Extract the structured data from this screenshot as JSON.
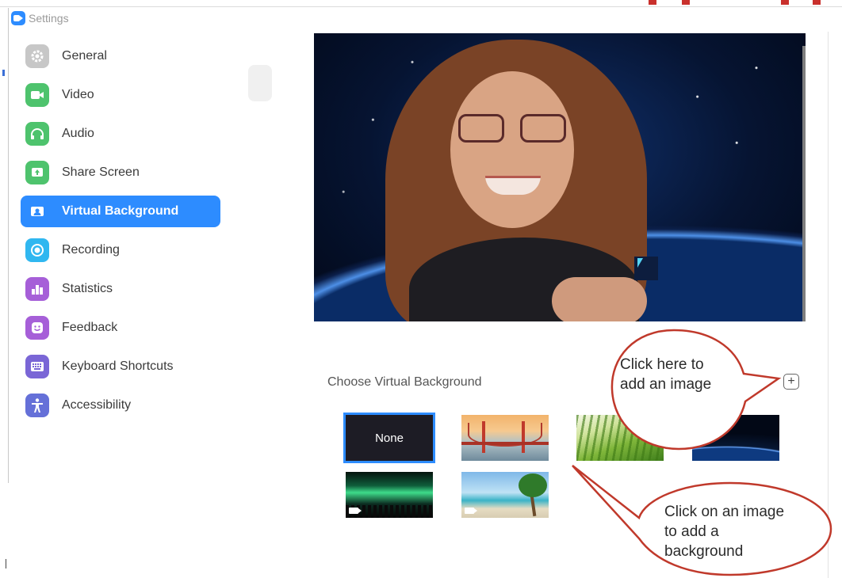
{
  "window": {
    "title": "Settings"
  },
  "sidebar": {
    "items": [
      {
        "label": "General",
        "icon": "gear-icon"
      },
      {
        "label": "Video",
        "icon": "camera-icon"
      },
      {
        "label": "Audio",
        "icon": "headphones-icon"
      },
      {
        "label": "Share Screen",
        "icon": "share-screen-icon"
      },
      {
        "label": "Virtual Background",
        "icon": "person-card-icon",
        "active": true
      },
      {
        "label": "Recording",
        "icon": "record-icon"
      },
      {
        "label": "Statistics",
        "icon": "bar-chart-icon"
      },
      {
        "label": "Feedback",
        "icon": "smiley-icon"
      },
      {
        "label": "Keyboard Shortcuts",
        "icon": "keyboard-icon"
      },
      {
        "label": "Accessibility",
        "icon": "accessibility-icon"
      }
    ]
  },
  "main": {
    "choose_label": "Choose Virtual Background",
    "add_button_symbol": "+",
    "backgrounds": [
      {
        "label": "None",
        "selected": true
      },
      {
        "label": "Golden Gate Bridge"
      },
      {
        "label": "Grass"
      },
      {
        "label": "Earth from space"
      },
      {
        "label": "Northern lights",
        "is_video": true
      },
      {
        "label": "Beach with palm tree",
        "is_video": true
      }
    ]
  },
  "annotations": {
    "callout_add": "Click here to add an image",
    "callout_click": "Click on an image to add a background"
  },
  "colors": {
    "accent": "#2d8cff",
    "callout_stroke": "#c0392b"
  }
}
